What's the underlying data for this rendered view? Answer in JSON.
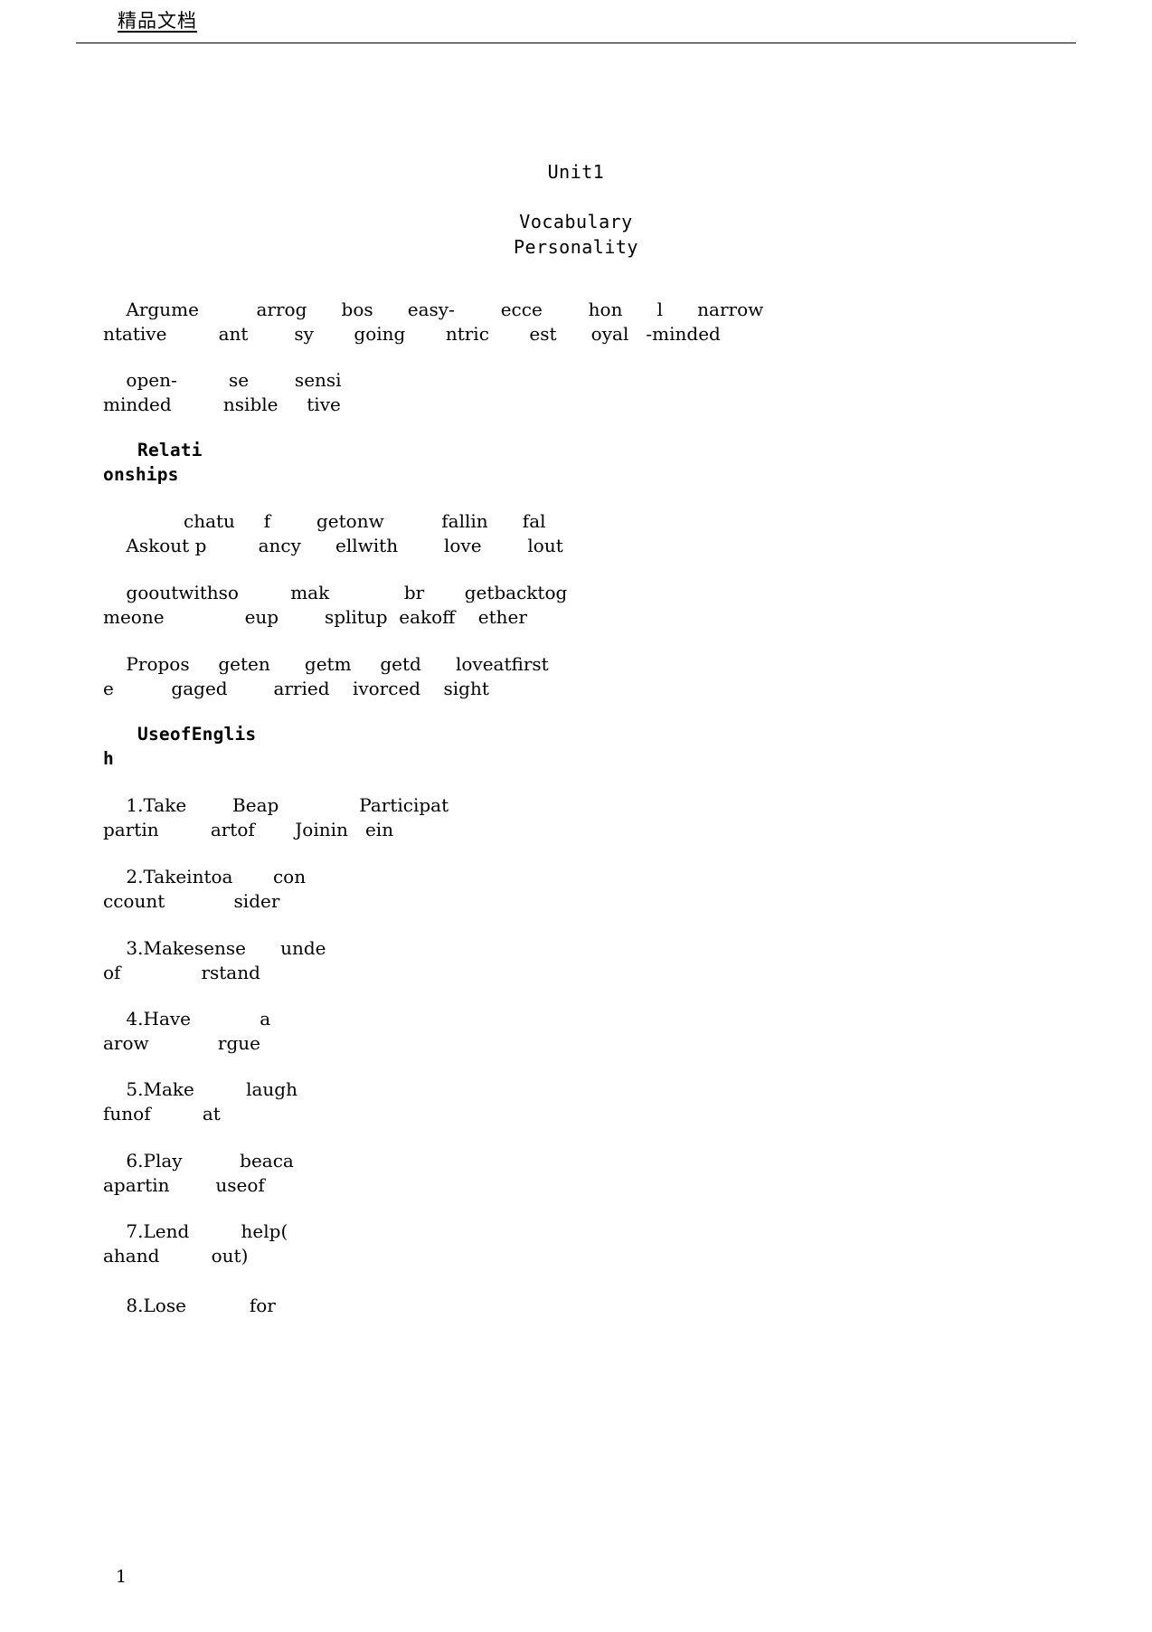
{
  "header": {
    "label": "精品文档"
  },
  "title": "Unit1",
  "sections": {
    "vocabulary_heading": "Vocabulary",
    "personality_heading": "Personality",
    "relationships_heading_line1": "Relati",
    "relationships_heading_line2": "onships",
    "useofenglish_heading_line1": "UseofEnglis",
    "useofenglish_heading_line2": "h"
  },
  "personality_rows": [
    {
      "top": [
        "Argume",
        "arrog",
        "bos",
        "easy-",
        "ecce",
        "hon",
        "l",
        "narrow"
      ],
      "bottom": [
        "ntative",
        "ant",
        "sy",
        "going",
        "ntric",
        "est",
        "oyal",
        "-minded"
      ]
    },
    {
      "top": [
        "open-",
        "se",
        "sensi"
      ],
      "bottom": [
        "minded",
        "nsible",
        "tive"
      ]
    }
  ],
  "relationship_rows": [
    {
      "top": [
        "chatu",
        "f",
        "getonw",
        "fallin",
        "fal"
      ],
      "bottom": [
        "Askout p",
        "ancy",
        "ellwith",
        "love",
        "lout"
      ]
    },
    {
      "top": [
        "gooutwithso",
        "mak",
        "br",
        "getbacktog"
      ],
      "bottom": [
        "meone",
        "eup",
        "splitup",
        "eakoff",
        "ether"
      ]
    },
    {
      "top": [
        "Propos",
        "geten",
        "getm",
        "getd",
        "loveatfirst"
      ],
      "bottom": [
        "e",
        "gaged",
        "arried",
        "ivorced",
        "sight"
      ]
    }
  ],
  "useofenglish_items": [
    {
      "number": "1.",
      "top": [
        "Take",
        "Beap",
        "Participat"
      ],
      "bottom": [
        "partin",
        "artof",
        "Joinin",
        "ein"
      ]
    },
    {
      "number": "2.",
      "top": [
        "Takeintoa",
        "con"
      ],
      "bottom": [
        "ccount",
        "sider"
      ]
    },
    {
      "number": "3.",
      "top": [
        "Makesense",
        "unde"
      ],
      "bottom": [
        "of",
        "rstand"
      ]
    },
    {
      "number": "4.",
      "top": [
        "Have",
        "a"
      ],
      "bottom": [
        "arow",
        "rgue"
      ]
    },
    {
      "number": "5.",
      "top": [
        "Make",
        "laugh"
      ],
      "bottom": [
        "funof",
        "at"
      ]
    },
    {
      "number": "6.",
      "top": [
        "Play",
        "beaca"
      ],
      "bottom": [
        "apartin",
        "useof"
      ]
    },
    {
      "number": "7.",
      "top": [
        "Lend",
        "help("
      ],
      "bottom": [
        "ahand",
        "out)"
      ]
    },
    {
      "number": "8.",
      "top": [
        "Lose",
        "for"
      ],
      "bottom": []
    }
  ],
  "lines": [
    {
      "id": "vocab_l1_top",
      "text": "    Argume          arrog      bos      easy-        ecce        hon      l      narrow"
    },
    {
      "id": "vocab_l1_bot",
      "text": "ntative         ant        sy       going       ntric       est      oyal   -minded"
    },
    {
      "id": "vocab_l2_top",
      "text": "    open-         se        sensi"
    },
    {
      "id": "vocab_l2_bot",
      "text": "minded         nsible     tive"
    },
    {
      "id": "rel_l1_top",
      "text": "              chatu     f        getonw          fallin      fal"
    },
    {
      "id": "rel_l1_bot",
      "text": "    Askout p         ancy      ellwith        love        lout"
    },
    {
      "id": "rel_l2_top",
      "text": "    gooutwithso         mak             br       getbacktog"
    },
    {
      "id": "rel_l2_bot",
      "text": "meone              eup        splitup  eakoff    ether"
    },
    {
      "id": "rel_l3_top",
      "text": "    Propos     geten      getm     getd      loveatfirst"
    },
    {
      "id": "rel_l3_bot",
      "text": "e          gaged        arried    ivorced    sight"
    },
    {
      "id": "uoe_1_top",
      "text": "    1.Take        Beap              Participat"
    },
    {
      "id": "uoe_1_bot",
      "text": "partin         artof       Joinin   ein"
    },
    {
      "id": "uoe_2_top",
      "text": "    2.Takeintoa       con"
    },
    {
      "id": "uoe_2_bot",
      "text": "ccount            sider"
    },
    {
      "id": "uoe_3_top",
      "text": "    3.Makesense      unde"
    },
    {
      "id": "uoe_3_bot",
      "text": "of              rstand"
    },
    {
      "id": "uoe_4_top",
      "text": "    4.Have            a"
    },
    {
      "id": "uoe_4_bot",
      "text": "arow            rgue"
    },
    {
      "id": "uoe_5_top",
      "text": "    5.Make         laugh"
    },
    {
      "id": "uoe_5_bot",
      "text": "funof         at"
    },
    {
      "id": "uoe_6_top",
      "text": "    6.Play          beaca"
    },
    {
      "id": "uoe_6_bot",
      "text": "apartin        useof"
    },
    {
      "id": "uoe_7_top",
      "text": "    7.Lend         help("
    },
    {
      "id": "uoe_7_bot",
      "text": "ahand         out)"
    },
    {
      "id": "uoe_8_top",
      "text": "    8.Lose           for"
    }
  ],
  "footer": {
    "page_number": "1"
  }
}
